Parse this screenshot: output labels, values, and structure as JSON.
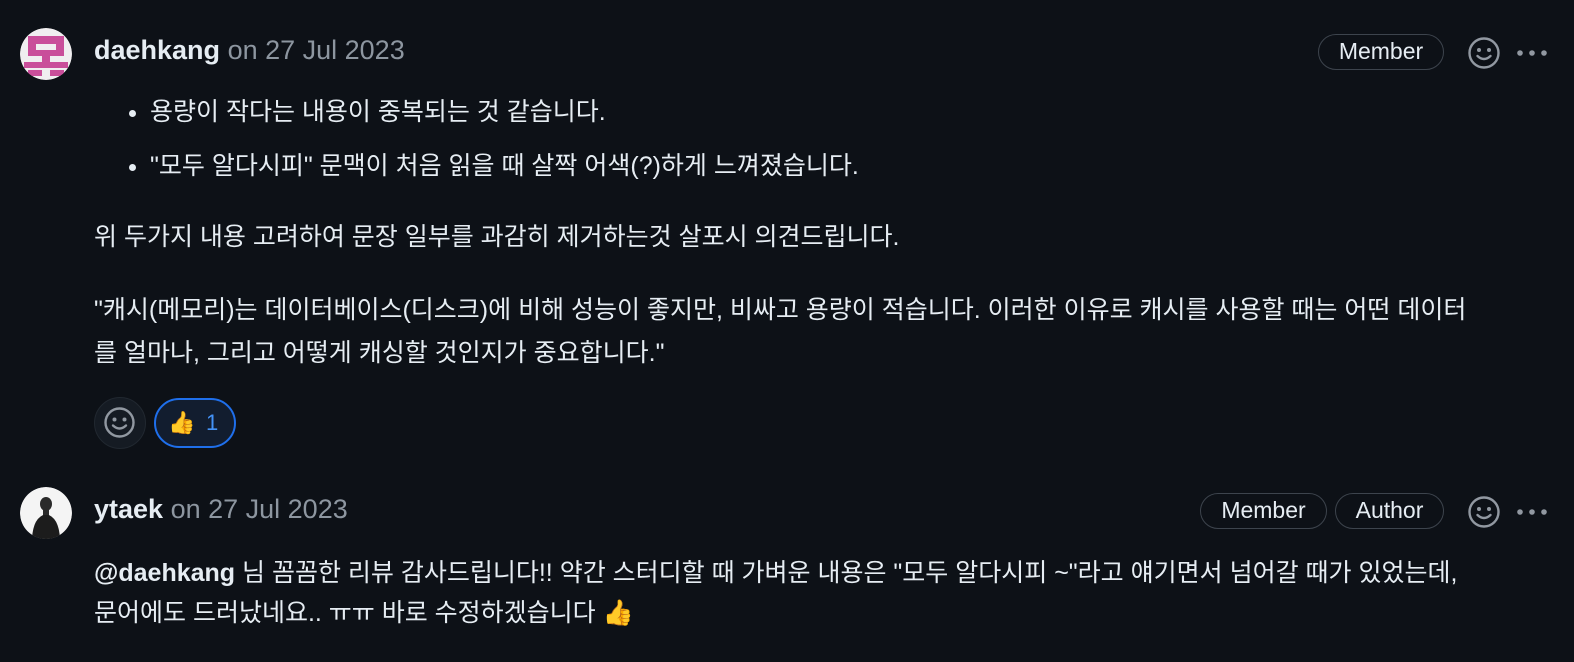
{
  "comments": [
    {
      "author": "daehkang",
      "timestamp": "on 27 Jul 2023",
      "badges": [
        "Member"
      ],
      "bullets": [
        "용량이 작다는 내용이 중복되는 것 같습니다.",
        "\"모두 알다시피\" 문맥이 처음 읽을 때 살짝 어색(?)하게 느껴졌습니다."
      ],
      "paragraphs": [
        "위 두가지 내용 고려하여 문장 일부를 과감히 제거하는것 살포시 의견드립니다.",
        "\"캐시(메모리)는 데이터베이스(디스크)에 비해 성능이 좋지만, 비싸고 용량이 적습니다. 이러한 이유로 캐시를 사용할 때는 어떤 데이터",
        "를 얼마나, 그리고 어떻게 캐싱할 것인지가 중요합니다.\""
      ],
      "reactions": [
        {
          "emoji": "👍",
          "count": "1"
        }
      ]
    },
    {
      "author": "ytaek",
      "timestamp": "on 27 Jul 2023",
      "badges": [
        "Member",
        "Author"
      ],
      "mention": "@daehkang",
      "line1_rest": " 님 꼼꼼한 리뷰 감사드립니다!! 약간 스터디할 때 가벼운 내용은 \"모두 알다시피 ~\"라고 얘기면서 넘어갈 때가 있었는데,",
      "line2": "문어에도 드러났네요.. ㅠㅠ 바로 수정하겠습니다 👍"
    }
  ],
  "icons": {
    "add_reaction": "smiley-icon",
    "more_options": "kebab-horizontal-icon"
  },
  "colors": {
    "background": "#0d1117",
    "text": "#e6edf3",
    "muted": "#8d96a0",
    "border": "#3d444d",
    "accent": "#1f6feb"
  }
}
